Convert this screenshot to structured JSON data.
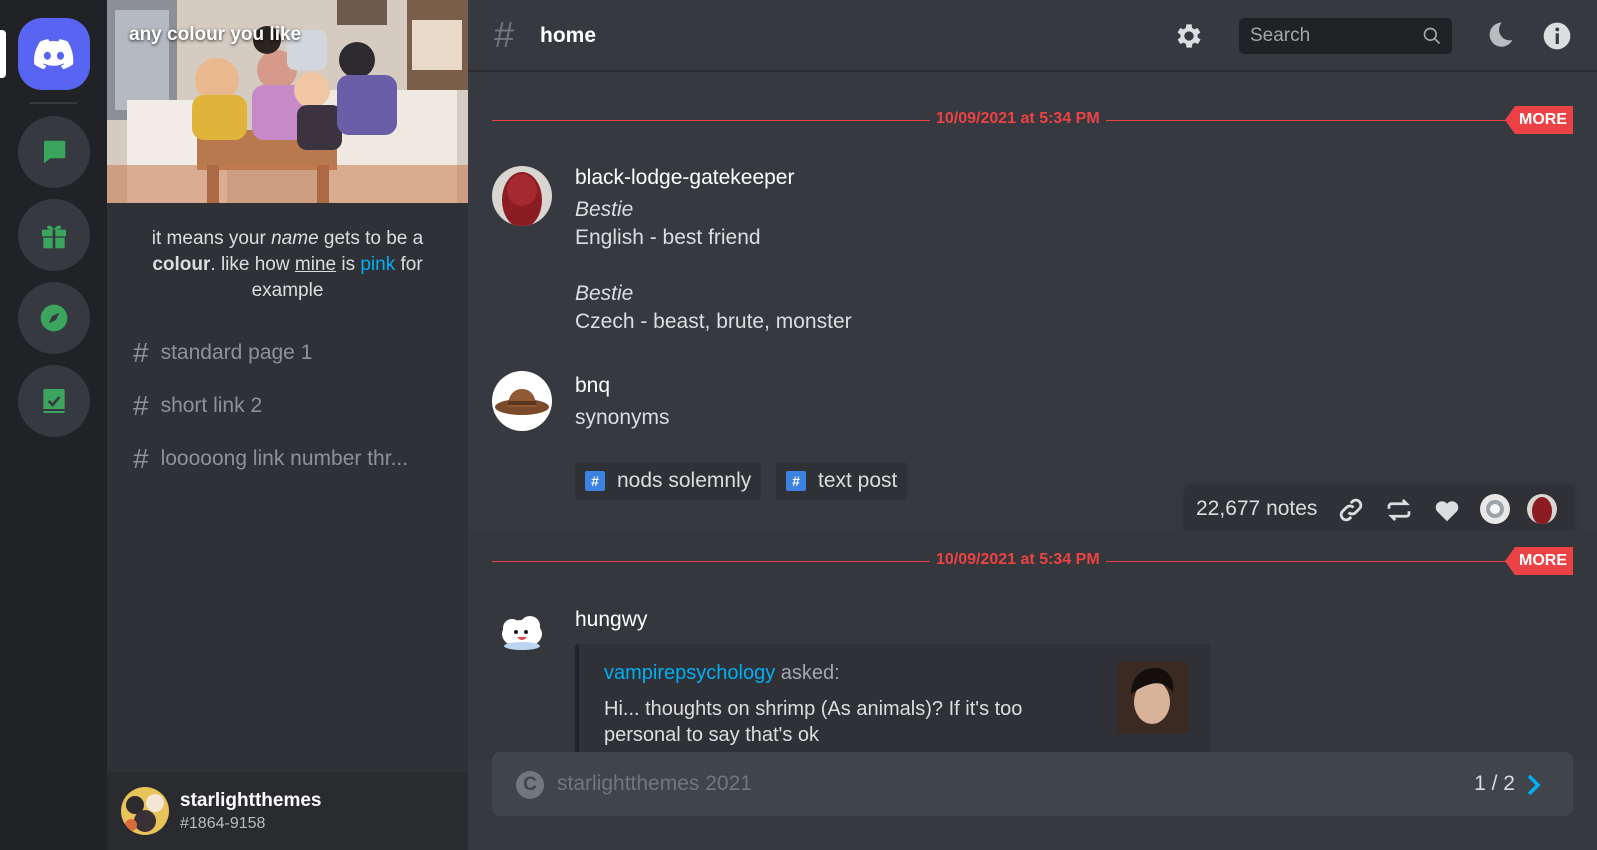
{
  "rail": {
    "items": [
      "discord-home",
      "messages",
      "gift",
      "explore",
      "book"
    ],
    "accent": "#5865f2",
    "icon_color": "#3ba55d"
  },
  "sidebar": {
    "banner_title": "any colour you like",
    "description": {
      "part1": "it means your ",
      "name_word": "name",
      "part2": " gets to be a ",
      "colour_word": "colour",
      "part3": ". like how ",
      "mine_word": "mine",
      "part4": " is ",
      "pink_word": "pink",
      "part5": " for example"
    },
    "channels": [
      {
        "label": "standard page 1"
      },
      {
        "label": "short link 2"
      },
      {
        "label": "looooong link number thr..."
      }
    ],
    "user": {
      "name": "starlightthemes",
      "tag": "#1864-9158"
    }
  },
  "header": {
    "channel": "home",
    "search_placeholder": "Search"
  },
  "posts": [
    {
      "date": "10/09/2021 at 5:34 PM",
      "more": "MORE",
      "messages": [
        {
          "author": "black-lodge-gatekeeper",
          "lines": [
            "Bestie",
            "English - best friend",
            "Bestie",
            "Czech - beast, brute, monster"
          ]
        },
        {
          "author": "bnq",
          "text": "synonyms"
        }
      ],
      "tags": [
        "nods solemnly",
        "text post"
      ],
      "notes": "22,677 notes"
    },
    {
      "date": "10/09/2021 at 5:34 PM",
      "more": "MORE",
      "messages": [
        {
          "author": "hungwy",
          "ask_user": "vampirepsychology",
          "ask_word": "asked:",
          "ask_text": "Hi... thoughts on shrimp (As animals)? If it's too personal to say that's ok"
        }
      ]
    }
  ],
  "footer": {
    "copyright": "starlightthemes 2021",
    "page": "1 / 2"
  },
  "colors": {
    "danger": "#ed4245",
    "link": "#00b0f4",
    "tag_icon": "#3c82e0"
  }
}
